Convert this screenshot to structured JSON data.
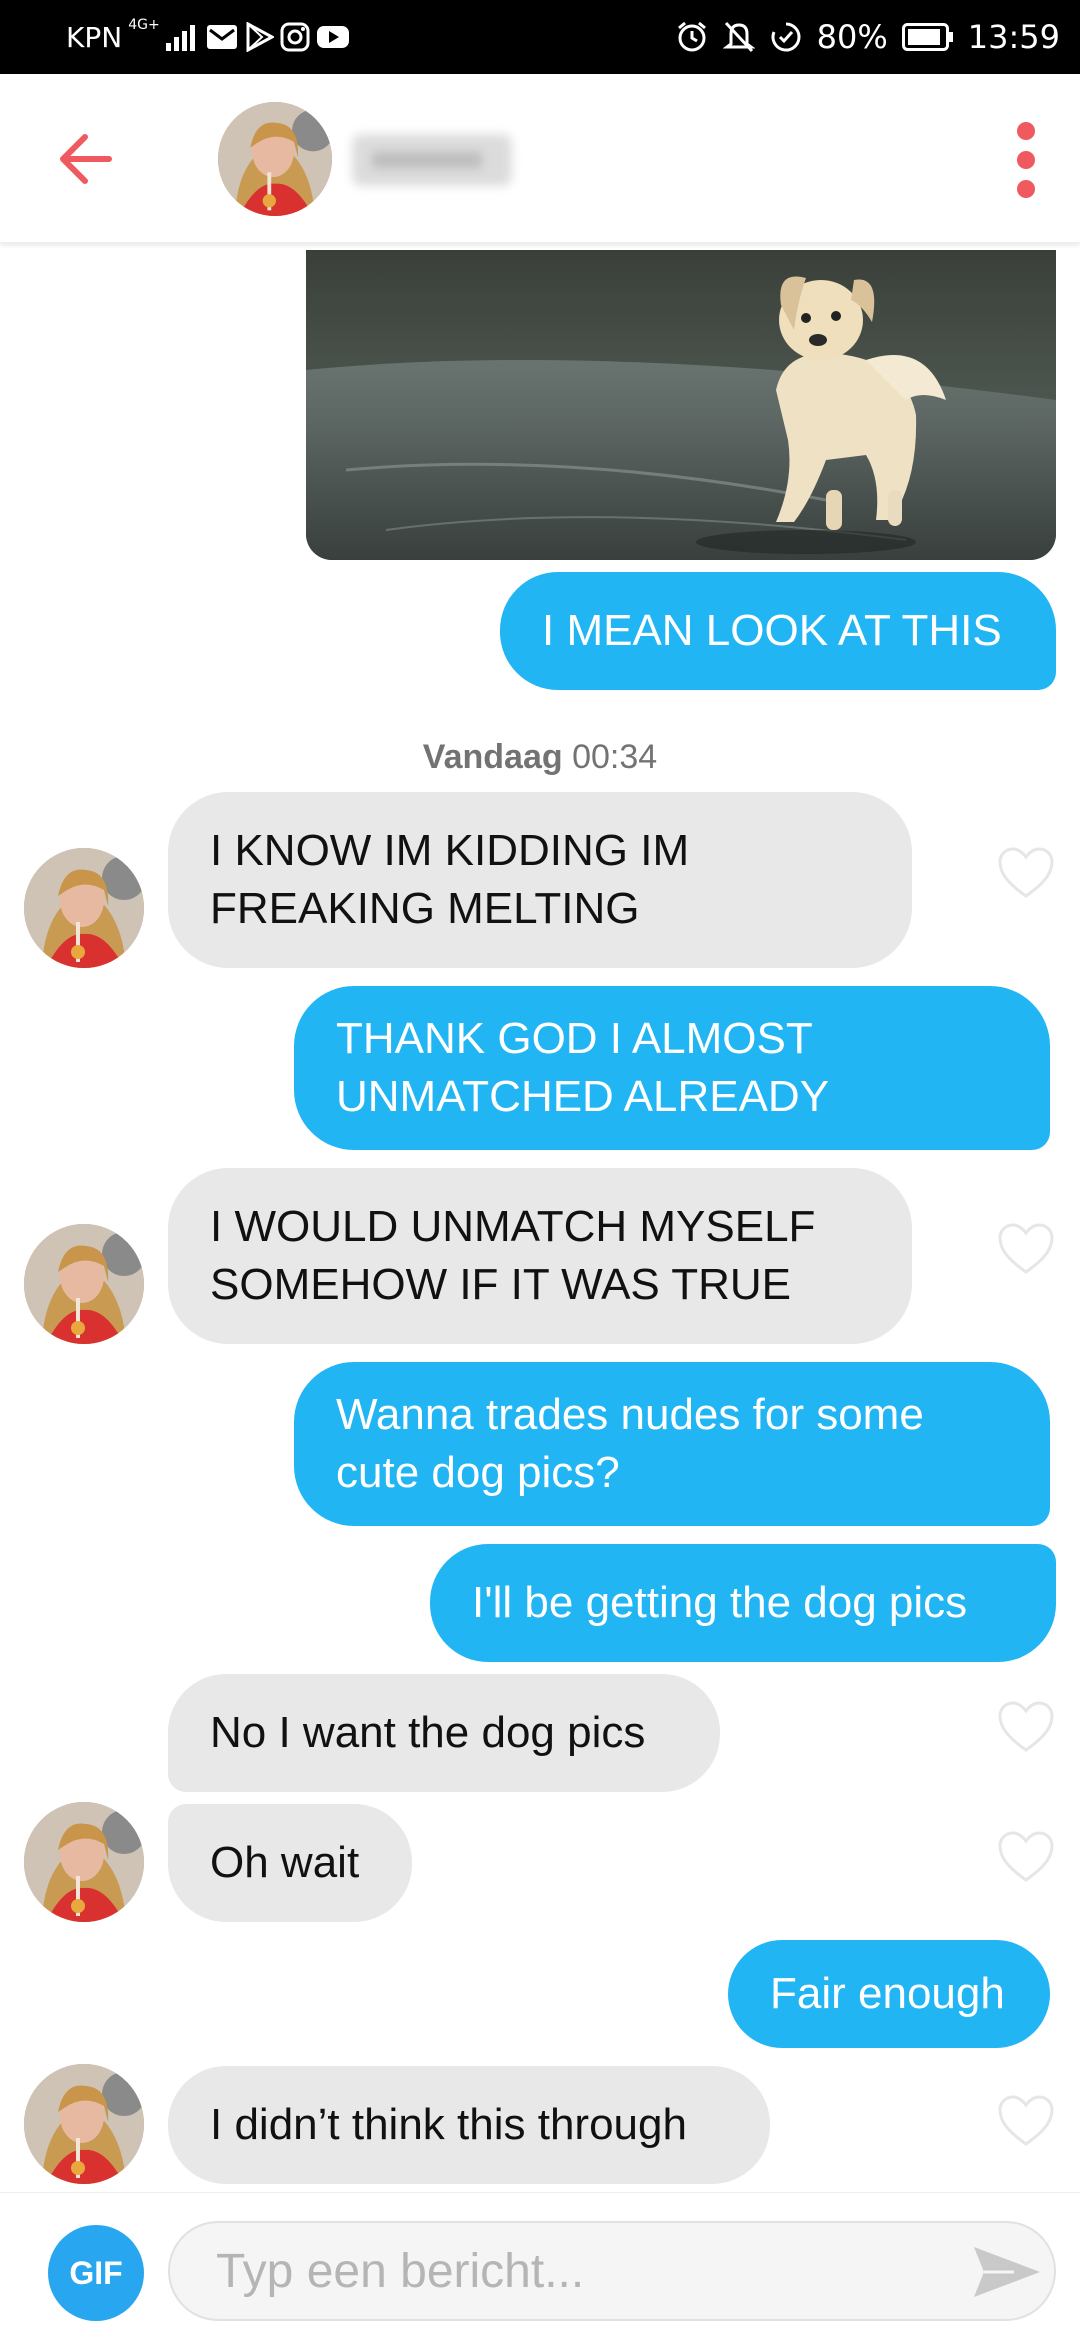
{
  "status_bar": {
    "carrier": "KPN",
    "network": "4G+",
    "battery": "80%",
    "time": "13:59",
    "left_icons": [
      "signal-icon",
      "mail-icon",
      "play-store-icon",
      "instagram-icon",
      "youtube-icon"
    ],
    "right_icons": [
      "alarm-icon",
      "bell-off-icon",
      "data-saver-icon",
      "battery-icon"
    ]
  },
  "header": {
    "back_icon": "arrow-left-icon",
    "menu_icon": "more-vertical-icon",
    "accent_color": "#ef5a61"
  },
  "chat": {
    "timestamp_day": "Vandaag",
    "timestamp_time": "00:34",
    "messages": [
      {
        "from": "me",
        "text": "I MEAN LOOK AT THIS"
      },
      {
        "from": "them",
        "text": "I KNOW IM KIDDING IM FREAKING MELTING"
      },
      {
        "from": "me",
        "text": "THANK GOD I ALMOST UNMATCHED ALREADY"
      },
      {
        "from": "them",
        "text": "I WOULD UNMATCH MYSELF SOMEHOW IF IT WAS TRUE"
      },
      {
        "from": "me",
        "text": "Wanna trades nudes for some cute dog pics?"
      },
      {
        "from": "me",
        "text": "I'll be getting the dog pics"
      },
      {
        "from": "them",
        "text": "No I want the dog pics"
      },
      {
        "from": "them",
        "text": "Oh wait"
      },
      {
        "from": "me",
        "text": "Fair enough"
      },
      {
        "from": "them",
        "text": "I didn’t think this through"
      }
    ],
    "sent_color": "#22b5f4",
    "received_color": "#e8e8e8"
  },
  "composer": {
    "gif_label": "GIF",
    "placeholder": "Typ een bericht...",
    "send_icon": "send-icon"
  }
}
